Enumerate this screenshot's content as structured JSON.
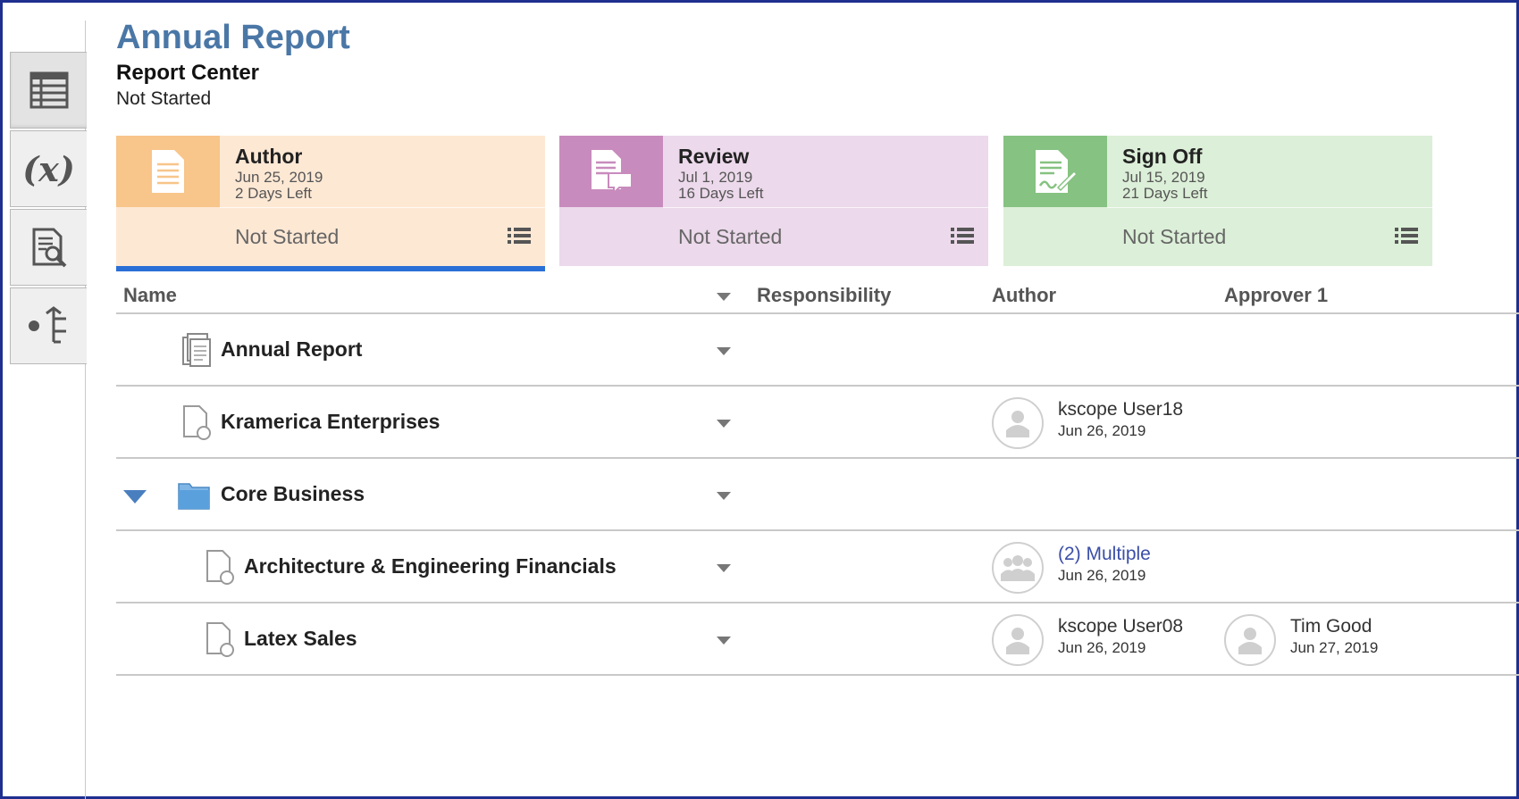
{
  "header": {
    "title": "Annual Report",
    "subtitle": "Report Center",
    "status": "Not Started"
  },
  "rail": {
    "items": [
      {
        "icon": "grid-table-icon",
        "active": true
      },
      {
        "icon": "variable-x-icon",
        "label": "(x)"
      },
      {
        "icon": "document-search-icon"
      },
      {
        "icon": "flow-branch-icon"
      }
    ]
  },
  "stages": [
    {
      "title": "Author",
      "date": "Jun 25, 2019",
      "left": "2 Days Left",
      "status": "Not Started",
      "icon": "document-icon",
      "color_icon": "#f8c58a",
      "color_bg": "#fde8d4",
      "selected": true
    },
    {
      "title": "Review",
      "date": "Jul 1, 2019",
      "left": "16 Days Left",
      "status": "Not Started",
      "icon": "document-comment-icon",
      "color_icon": "#c88bbd",
      "color_bg": "#ecd9eb",
      "selected": false
    },
    {
      "title": "Sign Off",
      "date": "Jul 15, 2019",
      "left": "21 Days Left",
      "status": "Not Started",
      "icon": "document-signature-icon",
      "color_icon": "#86c281",
      "color_bg": "#dcefd8",
      "selected": false
    }
  ],
  "table": {
    "columns": [
      "Name",
      "Responsibility",
      "Author",
      "Approver 1"
    ],
    "rows": [
      {
        "name": "Annual Report",
        "icon": "report-stack-icon",
        "author": null,
        "approver": null
      },
      {
        "name": "Kramerica Enterprises",
        "icon": "doc-pending-icon",
        "author": {
          "name": "kscope User18",
          "date": "Jun 26, 2019"
        },
        "approver": null
      },
      {
        "name": "Core Business",
        "icon": "folder-icon",
        "expanded": true,
        "author": null,
        "approver": null
      },
      {
        "name": "Architecture & Engineering Financials",
        "icon": "doc-pending-icon",
        "author": {
          "name": "(2) Multiple",
          "date": "Jun 26, 2019",
          "group": true
        },
        "approver": null
      },
      {
        "name": "Latex Sales",
        "icon": "doc-pending-icon",
        "author": {
          "name": "kscope User08",
          "date": "Jun 26, 2019"
        },
        "approver": {
          "name": "Tim Good",
          "date": "Jun 27, 2019"
        }
      }
    ]
  },
  "colors": {
    "title": "#4a77a6",
    "selection_underline": "#2a6fd6",
    "link": "#3b4fa8",
    "frame": "#1f2f8f"
  }
}
